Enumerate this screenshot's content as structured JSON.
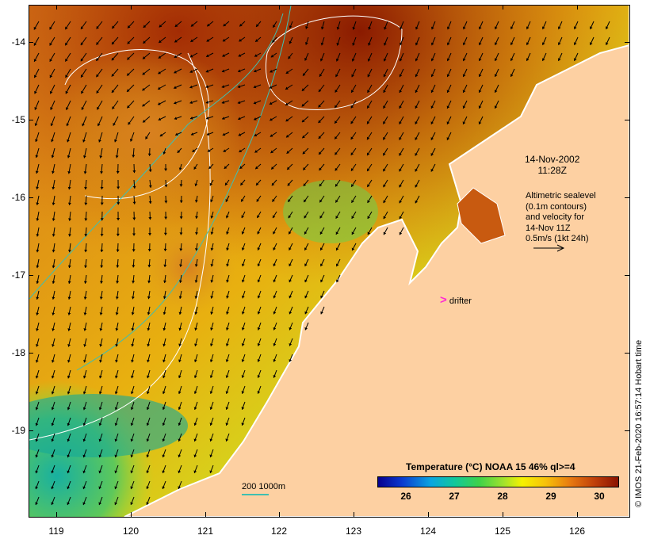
{
  "axes": {
    "y_labels": [
      "-14",
      "-15",
      "-16",
      "-17",
      "-18",
      "-19"
    ],
    "x_labels": [
      "119",
      "120",
      "121",
      "122",
      "123",
      "124",
      "125",
      "126"
    ]
  },
  "date": {
    "line1": "14-Nov-2002",
    "line2": "11:28Z"
  },
  "legend": {
    "line1": "Altimetric sealevel",
    "line2": "(0.1m contours)",
    "line3": "and velocity for",
    "line4": "14-Nov 11Z",
    "line5": "0.5m/s (1kt 24h)"
  },
  "drifter": {
    "symbol": ">",
    "label": "drifter"
  },
  "depth_legend": "200  1000m",
  "colorbar": {
    "title": "Temperature (°C) NOAA 15 46% ql>=4",
    "ticks": [
      "26",
      "27",
      "28",
      "29",
      "30"
    ]
  },
  "credit": "© IMOS 21-Feb-2020 16:57:14 Hobart time",
  "colors": {
    "land": "#fdd0a2",
    "coast": "#ffffff",
    "sealevel_contour": "#ffffff",
    "isobath": "#3fbfb0",
    "velocity_arrow": "#000000",
    "drifter": "#ff2ad4"
  }
}
